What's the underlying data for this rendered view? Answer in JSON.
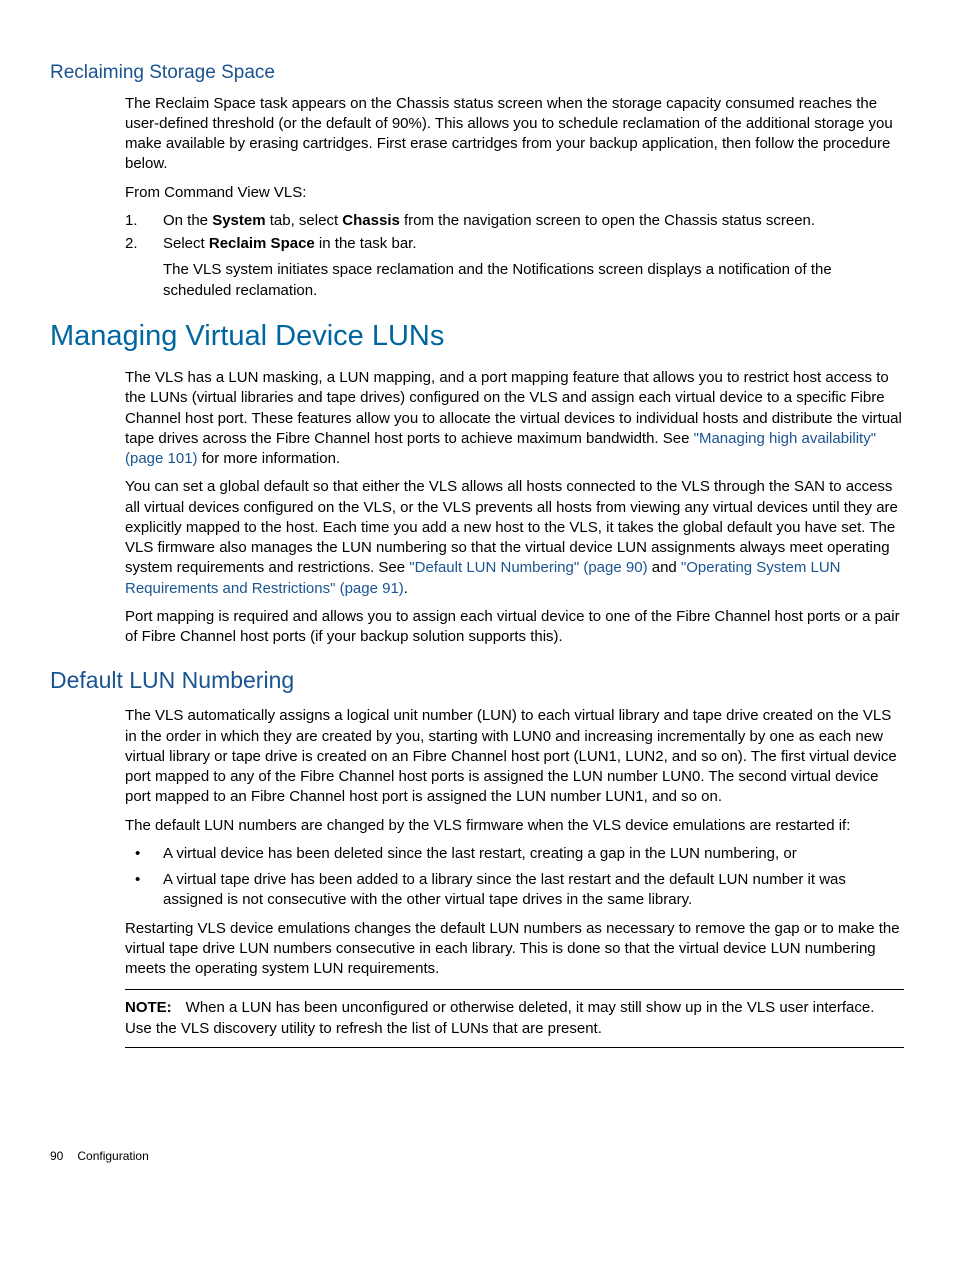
{
  "section1": {
    "title": "Reclaiming Storage Space",
    "para1": "The Reclaim Space task appears on the Chassis status screen when the storage capacity consumed reaches the user-defined threshold (or the default of 90%). This allows you to schedule reclamation of the additional storage you make available by erasing cartridges. First erase cartridges from your backup application, then follow the procedure below.",
    "para2": "From Command View VLS:",
    "step1_a": "On the ",
    "step1_b": "System",
    "step1_c": " tab, select ",
    "step1_d": "Chassis",
    "step1_e": " from the navigation screen to open the Chassis status screen.",
    "step2_a": "Select ",
    "step2_b": "Reclaim Space",
    "step2_c": " in the task bar.",
    "step2_sub": "The VLS system initiates space reclamation and the Notifications screen displays a notification of the scheduled reclamation.",
    "num1": "1.",
    "num2": "2."
  },
  "section2": {
    "title": "Managing Virtual Device LUNs",
    "para1_a": "The VLS has a LUN masking, a LUN mapping, and a port mapping feature that allows you to restrict host access to the LUNs (virtual libraries and tape drives) configured on the VLS and assign each virtual device to a specific Fibre Channel host port. These features allow you to allocate the virtual devices to individual hosts and distribute the virtual tape drives across the Fibre Channel host ports to achieve maximum bandwidth. See ",
    "para1_link": "\"Managing high availability\" (page 101)",
    "para1_b": " for more information.",
    "para2_a": "You can set a global default so that either the VLS allows all hosts connected to the VLS through the SAN to access all virtual devices configured on the VLS, or the VLS prevents all hosts from viewing any virtual devices until they are explicitly mapped to the host. Each time you add a new host to the VLS, it takes the global default you have set. The VLS firmware also manages the LUN numbering so that the virtual device LUN assignments always meet operating system requirements and restrictions. See ",
    "para2_link1": "\"Default LUN Numbering\" (page 90)",
    "para2_b": " and ",
    "para2_link2": "\"Operating System LUN Requirements and Restrictions\" (page 91)",
    "para2_c": ".",
    "para3": "Port mapping is required and allows you to assign each virtual device to one of the Fibre Channel host ports or a pair of Fibre Channel host ports (if your backup solution supports this)."
  },
  "section3": {
    "title": "Default LUN Numbering",
    "para1": "The VLS automatically assigns a logical unit number (LUN) to each virtual library and tape drive created on the VLS in the order in which they are created by you, starting with LUN0 and increasing incrementally by one as each new virtual library or tape drive is created on an Fibre Channel host port (LUN1, LUN2, and so on). The first virtual device port mapped to any of the Fibre Channel host ports is assigned the LUN number LUN0. The second virtual device port mapped to an Fibre Channel host port is assigned the LUN number LUN1, and so on.",
    "para2": "The default LUN numbers are changed by the VLS firmware when the VLS device emulations are restarted if:",
    "bullet1": "A virtual device has been deleted since the last restart, creating a gap in the LUN numbering, or",
    "bullet2": "A virtual tape drive has been added to a library since the last restart and the default LUN number it was assigned is not consecutive with the other virtual tape drives in the same library.",
    "para3": "Restarting VLS device emulations changes the default LUN numbers as necessary to remove the gap or to make the virtual tape drive LUN numbers consecutive in each library. This is done so that the virtual device LUN numbering meets the operating system LUN requirements.",
    "note_label": "NOTE:",
    "note_text": "When a LUN has been unconfigured or otherwise deleted, it may still show up in the VLS user interface. Use the VLS discovery utility to refresh the list of LUNs that are present.",
    "bullet_char": "•"
  },
  "footer": {
    "page": "90",
    "section": "Configuration"
  }
}
